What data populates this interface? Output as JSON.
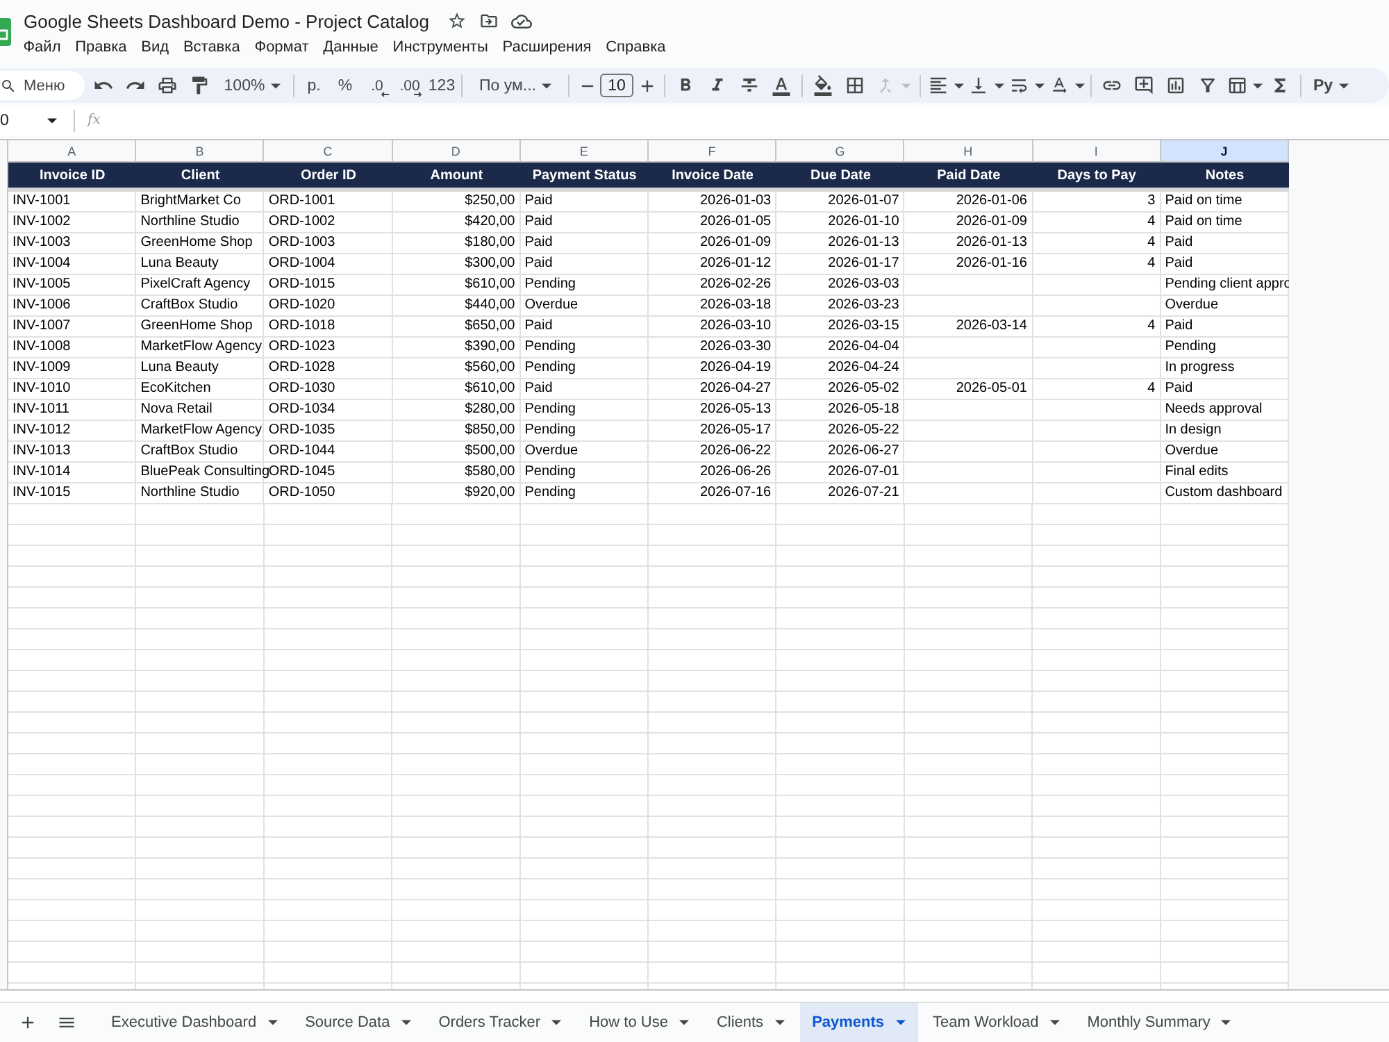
{
  "window": {
    "title": "Google Sheets Dashboard Demo - Project Catalog"
  },
  "menu": [
    "Файл",
    "Правка",
    "Вид",
    "Вставка",
    "Формат",
    "Данные",
    "Инструменты",
    "Расширения",
    "Справка"
  ],
  "toolbar": {
    "search": {
      "placeholder": "Меню"
    },
    "zoom": "100%",
    "currency": "р.",
    "percent": "%",
    "decrease_decimals": ".0",
    "increase_decimals": ".00",
    "number_format": "123",
    "font": "По ум...",
    "font_size": "10",
    "merge_cells": {
      "disabled": true
    },
    "input_tools": "Ру"
  },
  "formula_bar": {
    "cell_reference": "0",
    "function_label": "fx"
  },
  "table": {
    "columns": [
      {
        "letter": "A",
        "heading": "Invoice ID",
        "selected": false
      },
      {
        "letter": "B",
        "heading": "Client",
        "selected": false
      },
      {
        "letter": "C",
        "heading": "Order ID",
        "selected": false
      },
      {
        "letter": "D",
        "heading": "Amount",
        "selected": false
      },
      {
        "letter": "E",
        "heading": "Payment Status",
        "selected": false
      },
      {
        "letter": "F",
        "heading": "Invoice Date",
        "selected": false
      },
      {
        "letter": "G",
        "heading": "Due Date",
        "selected": false
      },
      {
        "letter": "H",
        "heading": "Paid Date",
        "selected": false
      },
      {
        "letter": "I",
        "heading": "Days to Pay",
        "selected": false
      },
      {
        "letter": "J",
        "heading": "Notes",
        "selected": true
      }
    ],
    "rows": [
      {
        "invoice_id": "INV-1001",
        "client": "BrightMarket Co",
        "order_id": "ORD-1001",
        "amount": "$250,00",
        "payment_status": "Paid",
        "invoice_date": "2026-01-03",
        "due_date": "2026-01-07",
        "paid_date": "2026-01-06",
        "days_to_pay": "3",
        "notes": "Paid on time"
      },
      {
        "invoice_id": "INV-1002",
        "client": "Northline Studio",
        "order_id": "ORD-1002",
        "amount": "$420,00",
        "payment_status": "Paid",
        "invoice_date": "2026-01-05",
        "due_date": "2026-01-10",
        "paid_date": "2026-01-09",
        "days_to_pay": "4",
        "notes": "Paid on time"
      },
      {
        "invoice_id": "INV-1003",
        "client": "GreenHome Shop",
        "order_id": "ORD-1003",
        "amount": "$180,00",
        "payment_status": "Paid",
        "invoice_date": "2026-01-09",
        "due_date": "2026-01-13",
        "paid_date": "2026-01-13",
        "days_to_pay": "4",
        "notes": "Paid"
      },
      {
        "invoice_id": "INV-1004",
        "client": "Luna Beauty",
        "order_id": "ORD-1004",
        "amount": "$300,00",
        "payment_status": "Paid",
        "invoice_date": "2026-01-12",
        "due_date": "2026-01-17",
        "paid_date": "2026-01-16",
        "days_to_pay": "4",
        "notes": "Paid"
      },
      {
        "invoice_id": "INV-1005",
        "client": "PixelCraft Agency",
        "order_id": "ORD-1015",
        "amount": "$610,00",
        "payment_status": "Pending",
        "invoice_date": "2026-02-26",
        "due_date": "2026-03-03",
        "notes": "Pending client appro"
      },
      {
        "invoice_id": "INV-1006",
        "client": "CraftBox Studio",
        "order_id": "ORD-1020",
        "amount": "$440,00",
        "payment_status": "Overdue",
        "invoice_date": "2026-03-18",
        "due_date": "2026-03-23",
        "notes": "Overdue"
      },
      {
        "invoice_id": "INV-1007",
        "client": "GreenHome Shop",
        "order_id": "ORD-1018",
        "amount": "$650,00",
        "payment_status": "Paid",
        "invoice_date": "2026-03-10",
        "due_date": "2026-03-15",
        "paid_date": "2026-03-14",
        "days_to_pay": "4",
        "notes": "Paid"
      },
      {
        "invoice_id": "INV-1008",
        "client": "MarketFlow Agency",
        "order_id": "ORD-1023",
        "amount": "$390,00",
        "payment_status": "Pending",
        "invoice_date": "2026-03-30",
        "due_date": "2026-04-04",
        "notes": "Pending"
      },
      {
        "invoice_id": "INV-1009",
        "client": "Luna Beauty",
        "order_id": "ORD-1028",
        "amount": "$560,00",
        "payment_status": "Pending",
        "invoice_date": "2026-04-19",
        "due_date": "2026-04-24",
        "notes": "In progress"
      },
      {
        "invoice_id": "INV-1010",
        "client": "EcoKitchen",
        "order_id": "ORD-1030",
        "amount": "$610,00",
        "payment_status": "Paid",
        "invoice_date": "2026-04-27",
        "due_date": "2026-05-02",
        "paid_date": "2026-05-01",
        "days_to_pay": "4",
        "notes": "Paid"
      },
      {
        "invoice_id": "INV-1011",
        "client": "Nova Retail",
        "order_id": "ORD-1034",
        "amount": "$280,00",
        "payment_status": "Pending",
        "invoice_date": "2026-05-13",
        "due_date": "2026-05-18",
        "notes": "Needs approval"
      },
      {
        "invoice_id": "INV-1012",
        "client": "MarketFlow Agency",
        "order_id": "ORD-1035",
        "amount": "$850,00",
        "payment_status": "Pending",
        "invoice_date": "2026-05-17",
        "due_date": "2026-05-22",
        "notes": "In design"
      },
      {
        "invoice_id": "INV-1013",
        "client": "CraftBox Studio",
        "order_id": "ORD-1044",
        "amount": "$500,00",
        "payment_status": "Overdue",
        "invoice_date": "2026-06-22",
        "due_date": "2026-06-27",
        "notes": "Overdue"
      },
      {
        "invoice_id": "INV-1014",
        "client": "BluePeak Consulting",
        "order_id": "ORD-1045",
        "amount": "$580,00",
        "payment_status": "Pending",
        "invoice_date": "2026-06-26",
        "due_date": "2026-07-01",
        "notes": "Final edits"
      },
      {
        "invoice_id": "INV-1015",
        "client": "Northline Studio",
        "order_id": "ORD-1050",
        "amount": "$920,00",
        "payment_status": "Pending",
        "invoice_date": "2026-07-16",
        "due_date": "2026-07-21",
        "notes": "Custom dashboard"
      }
    ]
  },
  "sheet_tabs": [
    {
      "label": "Executive Dashboard",
      "selected": false
    },
    {
      "label": "Source Data",
      "selected": false
    },
    {
      "label": "Orders Tracker",
      "selected": false
    },
    {
      "label": "How to Use",
      "selected": false
    },
    {
      "label": "Clients",
      "selected": false
    },
    {
      "label": "Payments",
      "selected": true
    },
    {
      "label": "Team Workload",
      "selected": false
    },
    {
      "label": "Monthly Summary",
      "selected": false
    }
  ]
}
